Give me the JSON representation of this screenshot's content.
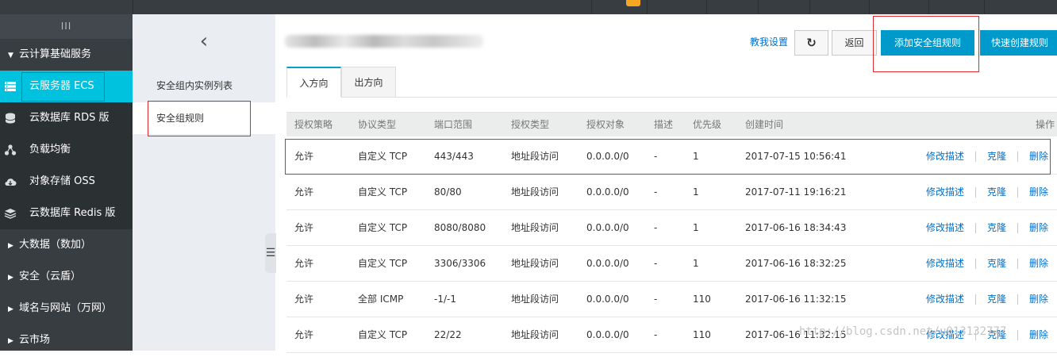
{
  "topbar": {
    "collapse_glyph": "III"
  },
  "sidebar": {
    "collapse": "III",
    "groups": [
      {
        "label": "云计算基础服务"
      },
      {
        "label": "大数据（数加）"
      },
      {
        "label": "安全（云盾）"
      },
      {
        "label": "域名与网站（万网）"
      },
      {
        "label": "云市场"
      }
    ],
    "items": [
      {
        "label": "云服务器 ECS",
        "icon": "server-icon"
      },
      {
        "label": "云数据库 RDS 版",
        "icon": "database-icon"
      },
      {
        "label": "负载均衡",
        "icon": "load-balancer-icon"
      },
      {
        "label": "对象存储 OSS",
        "icon": "cloud-storage-icon"
      },
      {
        "label": "云数据库 Redis 版",
        "icon": "layers-icon"
      }
    ]
  },
  "subnav": {
    "back_glyph": "‹",
    "items": [
      {
        "label": "安全组内实例列表"
      },
      {
        "label": "安全组规则"
      }
    ],
    "toggle_glyph": "☰"
  },
  "toolbar": {
    "teach_label": "教我设置",
    "refresh_glyph": "↻",
    "back_label": "返回",
    "add_label": "添加安全组规则",
    "quick_label": "快速创建规则"
  },
  "tabs": [
    {
      "label": "入方向"
    },
    {
      "label": "出方向"
    }
  ],
  "table": {
    "headers": [
      "授权策略",
      "协议类型",
      "端口范围",
      "授权类型",
      "授权对象",
      "描述",
      "优先级",
      "创建时间",
      "操作"
    ],
    "rows": [
      {
        "policy": "允许",
        "protocol": "自定义 TCP",
        "port": "443/443",
        "auth_type": "地址段访问",
        "target": "0.0.0.0/0",
        "desc": "-",
        "priority": "1",
        "created": "2017-07-15 10:56:41"
      },
      {
        "policy": "允许",
        "protocol": "自定义 TCP",
        "port": "80/80",
        "auth_type": "地址段访问",
        "target": "0.0.0.0/0",
        "desc": "-",
        "priority": "1",
        "created": "2017-07-11 19:16:21"
      },
      {
        "policy": "允许",
        "protocol": "自定义 TCP",
        "port": "8080/8080",
        "auth_type": "地址段访问",
        "target": "0.0.0.0/0",
        "desc": "-",
        "priority": "1",
        "created": "2017-06-16 18:34:43"
      },
      {
        "policy": "允许",
        "protocol": "自定义 TCP",
        "port": "3306/3306",
        "auth_type": "地址段访问",
        "target": "0.0.0.0/0",
        "desc": "-",
        "priority": "1",
        "created": "2017-06-16 18:32:25"
      },
      {
        "policy": "允许",
        "protocol": "全部 ICMP",
        "port": "-1/-1",
        "auth_type": "地址段访问",
        "target": "0.0.0.0/0",
        "desc": "-",
        "priority": "110",
        "created": "2017-06-16 11:32:15"
      },
      {
        "policy": "允许",
        "protocol": "自定义 TCP",
        "port": "22/22",
        "auth_type": "地址段访问",
        "target": "0.0.0.0/0",
        "desc": "-",
        "priority": "110",
        "created": "2017-06-16 11:32:15"
      }
    ],
    "actions": {
      "edit": "修改描述",
      "clone": "克隆",
      "delete": "删除"
    }
  },
  "watermark": "http://blog.csdn.net/u013132777"
}
